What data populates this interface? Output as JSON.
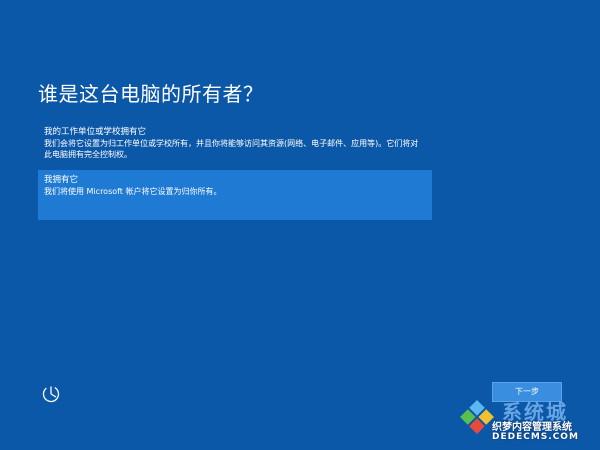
{
  "page": {
    "title": "谁是这台电脑的所有者？"
  },
  "options": [
    {
      "title": "我的工作单位或学校拥有它",
      "description": "我们会将它设置为归工作单位或学校所有，并且你将能够访问其资源(网络、电子邮件、应用等)。它们将对此电脑拥有完全控制权。",
      "selected": false
    },
    {
      "title": "我拥有它",
      "description": "我们将使用 Microsoft 帐户将它设置为归你所有。",
      "selected": true
    }
  ],
  "footer": {
    "ease_of_access_icon": "ease-of-access-icon",
    "next_label": "下一步"
  },
  "watermark": {
    "brand": "系统城",
    "line1": "织梦内容管理系统",
    "line2": "DEDECMS.COM"
  },
  "colors": {
    "background": "#0c58a8",
    "selected_option": "#1f7ad3",
    "button": "#3a8ee0"
  }
}
